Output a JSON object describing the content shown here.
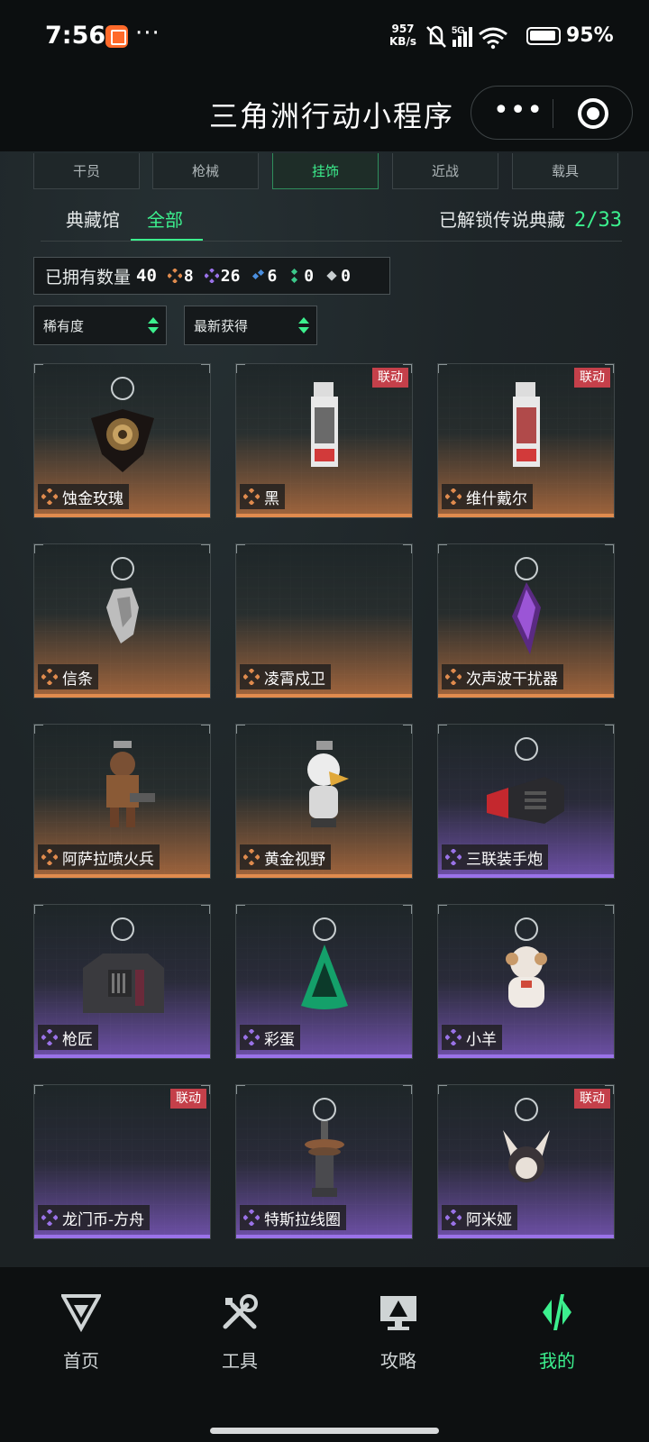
{
  "status_bar": {
    "time": "7:56",
    "dots": "···",
    "net_speed_value": "957",
    "net_speed_unit": "KB/s",
    "signal_label": "5G",
    "battery": "95%"
  },
  "app": {
    "title": "三角洲行动小程序"
  },
  "category_tabs": [
    "干员",
    "枪械",
    "挂饰",
    "近战",
    "载具"
  ],
  "active_category": "挂饰",
  "sub_tabs": [
    "典藏馆",
    "全部"
  ],
  "active_sub_tab": "全部",
  "legend_unlocked_label": "已解锁传说典藏",
  "legend_unlocked_count": "2/33",
  "owned": {
    "label": "已拥有数量",
    "total": "40",
    "rarities": [
      {
        "name": "gold",
        "color": "#e08b4e",
        "count": "8"
      },
      {
        "name": "purple",
        "color": "#9a72e8",
        "count": "26"
      },
      {
        "name": "blue",
        "color": "#4a8fe0",
        "count": "6"
      },
      {
        "name": "green",
        "color": "#3cc88a",
        "count": "0"
      },
      {
        "name": "white",
        "color": "#c8ced0",
        "count": "0"
      }
    ]
  },
  "filters": {
    "rarity": "稀有度",
    "sort": "最新获得"
  },
  "collab_label": "联动",
  "items": [
    {
      "name": "蚀金玫瑰",
      "rarity": "gold",
      "collab": false,
      "icon": "rose-charm-icon"
    },
    {
      "name": "黑",
      "rarity": "gold",
      "collab": true,
      "icon": "card-charm-icon"
    },
    {
      "name": "维什戴尔",
      "rarity": "gold",
      "collab": true,
      "icon": "card-charm-icon"
    },
    {
      "name": "信条",
      "rarity": "gold",
      "collab": false,
      "icon": "cloth-charm-icon"
    },
    {
      "name": "凌霄戍卫",
      "rarity": "gold",
      "collab": false,
      "icon": ""
    },
    {
      "name": "次声波干扰器",
      "rarity": "gold",
      "collab": false,
      "icon": "crystal-charm-icon"
    },
    {
      "name": "阿萨拉喷火兵",
      "rarity": "gold",
      "collab": false,
      "icon": "soldier-charm-icon"
    },
    {
      "name": "黄金视野",
      "rarity": "gold",
      "collab": false,
      "icon": "bird-charm-icon"
    },
    {
      "name": "三联装手炮",
      "rarity": "purple",
      "collab": false,
      "icon": "cannon-charm-icon"
    },
    {
      "name": "枪匠",
      "rarity": "purple",
      "collab": false,
      "icon": "case-charm-icon"
    },
    {
      "name": "彩蛋",
      "rarity": "purple",
      "collab": false,
      "icon": "triangle-charm-icon"
    },
    {
      "name": "小羊",
      "rarity": "purple",
      "collab": false,
      "icon": "sheep-charm-icon"
    },
    {
      "name": "龙门币-方舟",
      "rarity": "purple",
      "collab": true,
      "icon": ""
    },
    {
      "name": "特斯拉线圈",
      "rarity": "purple",
      "collab": false,
      "icon": "coil-charm-icon"
    },
    {
      "name": "阿米娅",
      "rarity": "purple",
      "collab": true,
      "icon": "rabbit-charm-icon"
    }
  ],
  "bottom_nav": [
    {
      "label": "首页",
      "icon": "home-logo-icon"
    },
    {
      "label": "工具",
      "icon": "tools-icon"
    },
    {
      "label": "攻略",
      "icon": "guide-monitor-icon"
    },
    {
      "label": "我的",
      "icon": "profile-logo-icon"
    }
  ],
  "active_nav": "我的"
}
